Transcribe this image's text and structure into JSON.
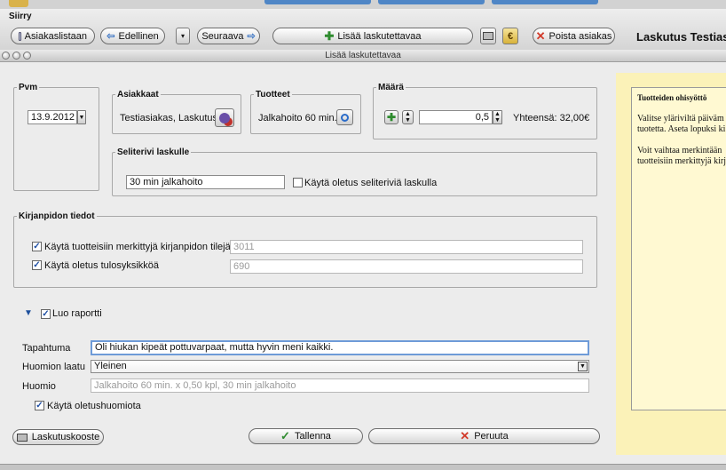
{
  "toolbar": {
    "siirry_label": "Siirry",
    "back_to_list": "Asiakaslistaan",
    "previous": "Edellinen",
    "next": "Seuraava",
    "add_billable": "Lisää laskutettavaa",
    "delete_customer": "Poista asiakas",
    "app_title": "Laskutus Testias"
  },
  "dialog": {
    "title": "Lisää laskutettavaa",
    "pvm": {
      "legend": "Pvm",
      "date": "13.9.2012"
    },
    "asiakkaat": {
      "legend": "Asiakkaat",
      "value": "Testiasiakas, Laskutus"
    },
    "tuotteet": {
      "legend": "Tuotteet",
      "value": "Jalkahoito 60 min."
    },
    "maara": {
      "legend": "Määrä",
      "quantity": "0,5",
      "total": "Yhteensä: 32,00€"
    },
    "seliterivi": {
      "legend": "Seliterivi laskulle",
      "value": "30 min jalkahoito",
      "default_label": "Käytä oletus seliteriviä laskulla",
      "default_checked": false
    },
    "kirjanpito": {
      "legend": "Kirjanpidon tiedot",
      "accounts_label": "Käytä tuotteisiin merkittyjä kirjanpidon tilejä",
      "accounts_value": "3011",
      "accounts_checked": true,
      "unit_label": "Käytä oletus tulosyksikköä",
      "unit_value": "690",
      "unit_checked": true
    },
    "raportti": {
      "create_label": "Luo raportti",
      "create_checked": true,
      "event_label": "Tapahtuma",
      "event_value": "Oli hiukan kipeät pottuvarpaat, mutta hyvin meni kaikki.",
      "note_type_label": "Huomion laatu",
      "note_type_value": "Yleinen",
      "note_label": "Huomio",
      "note_placeholder": "Jalkahoito 60 min. x 0,50 kpl, 30 min jalkahoito",
      "default_note_label": "Käytä oletushuomiota",
      "default_note_checked": true
    },
    "buttons": {
      "summary": "Laskutuskooste",
      "save": "Tallenna",
      "cancel": "Peruuta"
    },
    "help": {
      "title": "Tuotteiden ohisyöttö",
      "lines": [
        "Valitse yläriviltä päiväm",
        "tuotetta. Aseta lopuksi ki",
        "Voit vaihtaa merkintään",
        "tuotteisiin merkittyjä kirj"
      ]
    }
  },
  "colors": {
    "accent": "#4f86c6",
    "help_background": "#fbf2b8",
    "focus_border": "#6e9bd8",
    "check_mark": "#1f4fa5",
    "plus_green": "#2e8b2e",
    "cancel_red": "#d23a2a"
  },
  "icons": [
    "back-icon",
    "previous-arrow-icon",
    "next-arrow-icon",
    "plus-icon",
    "printer-icon",
    "euro-icon",
    "close-x-icon",
    "customer-add-icon",
    "search-icon",
    "checkmark-icon",
    "disclosure-triangle-icon",
    "popup-arrow-icon"
  ]
}
